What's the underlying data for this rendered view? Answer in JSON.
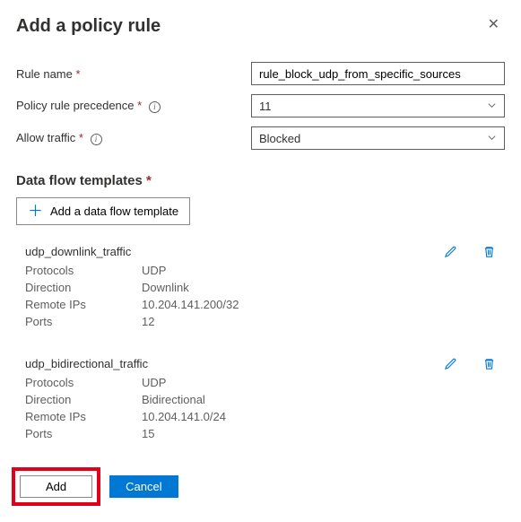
{
  "header": {
    "title": "Add a policy rule"
  },
  "form": {
    "ruleName": {
      "label": "Rule name",
      "value": "rule_block_udp_from_specific_sources"
    },
    "precedence": {
      "label": "Policy rule precedence",
      "value": "11"
    },
    "allowTraffic": {
      "label": "Allow traffic",
      "value": "Blocked"
    }
  },
  "dataFlow": {
    "sectionLabel": "Data flow templates",
    "addBtn": "Add a data flow template",
    "keys": {
      "protocols": "Protocols",
      "direction": "Direction",
      "remoteIps": "Remote IPs",
      "ports": "Ports"
    },
    "templates": [
      {
        "name": "udp_downlink_traffic",
        "protocols": "UDP",
        "direction": "Downlink",
        "remoteIps": "10.204.141.200/32",
        "ports": "12"
      },
      {
        "name": "udp_bidirectional_traffic",
        "protocols": "UDP",
        "direction": "Bidirectional",
        "remoteIps": "10.204.141.0/24",
        "ports": "15"
      }
    ]
  },
  "footer": {
    "add": "Add",
    "cancel": "Cancel"
  }
}
